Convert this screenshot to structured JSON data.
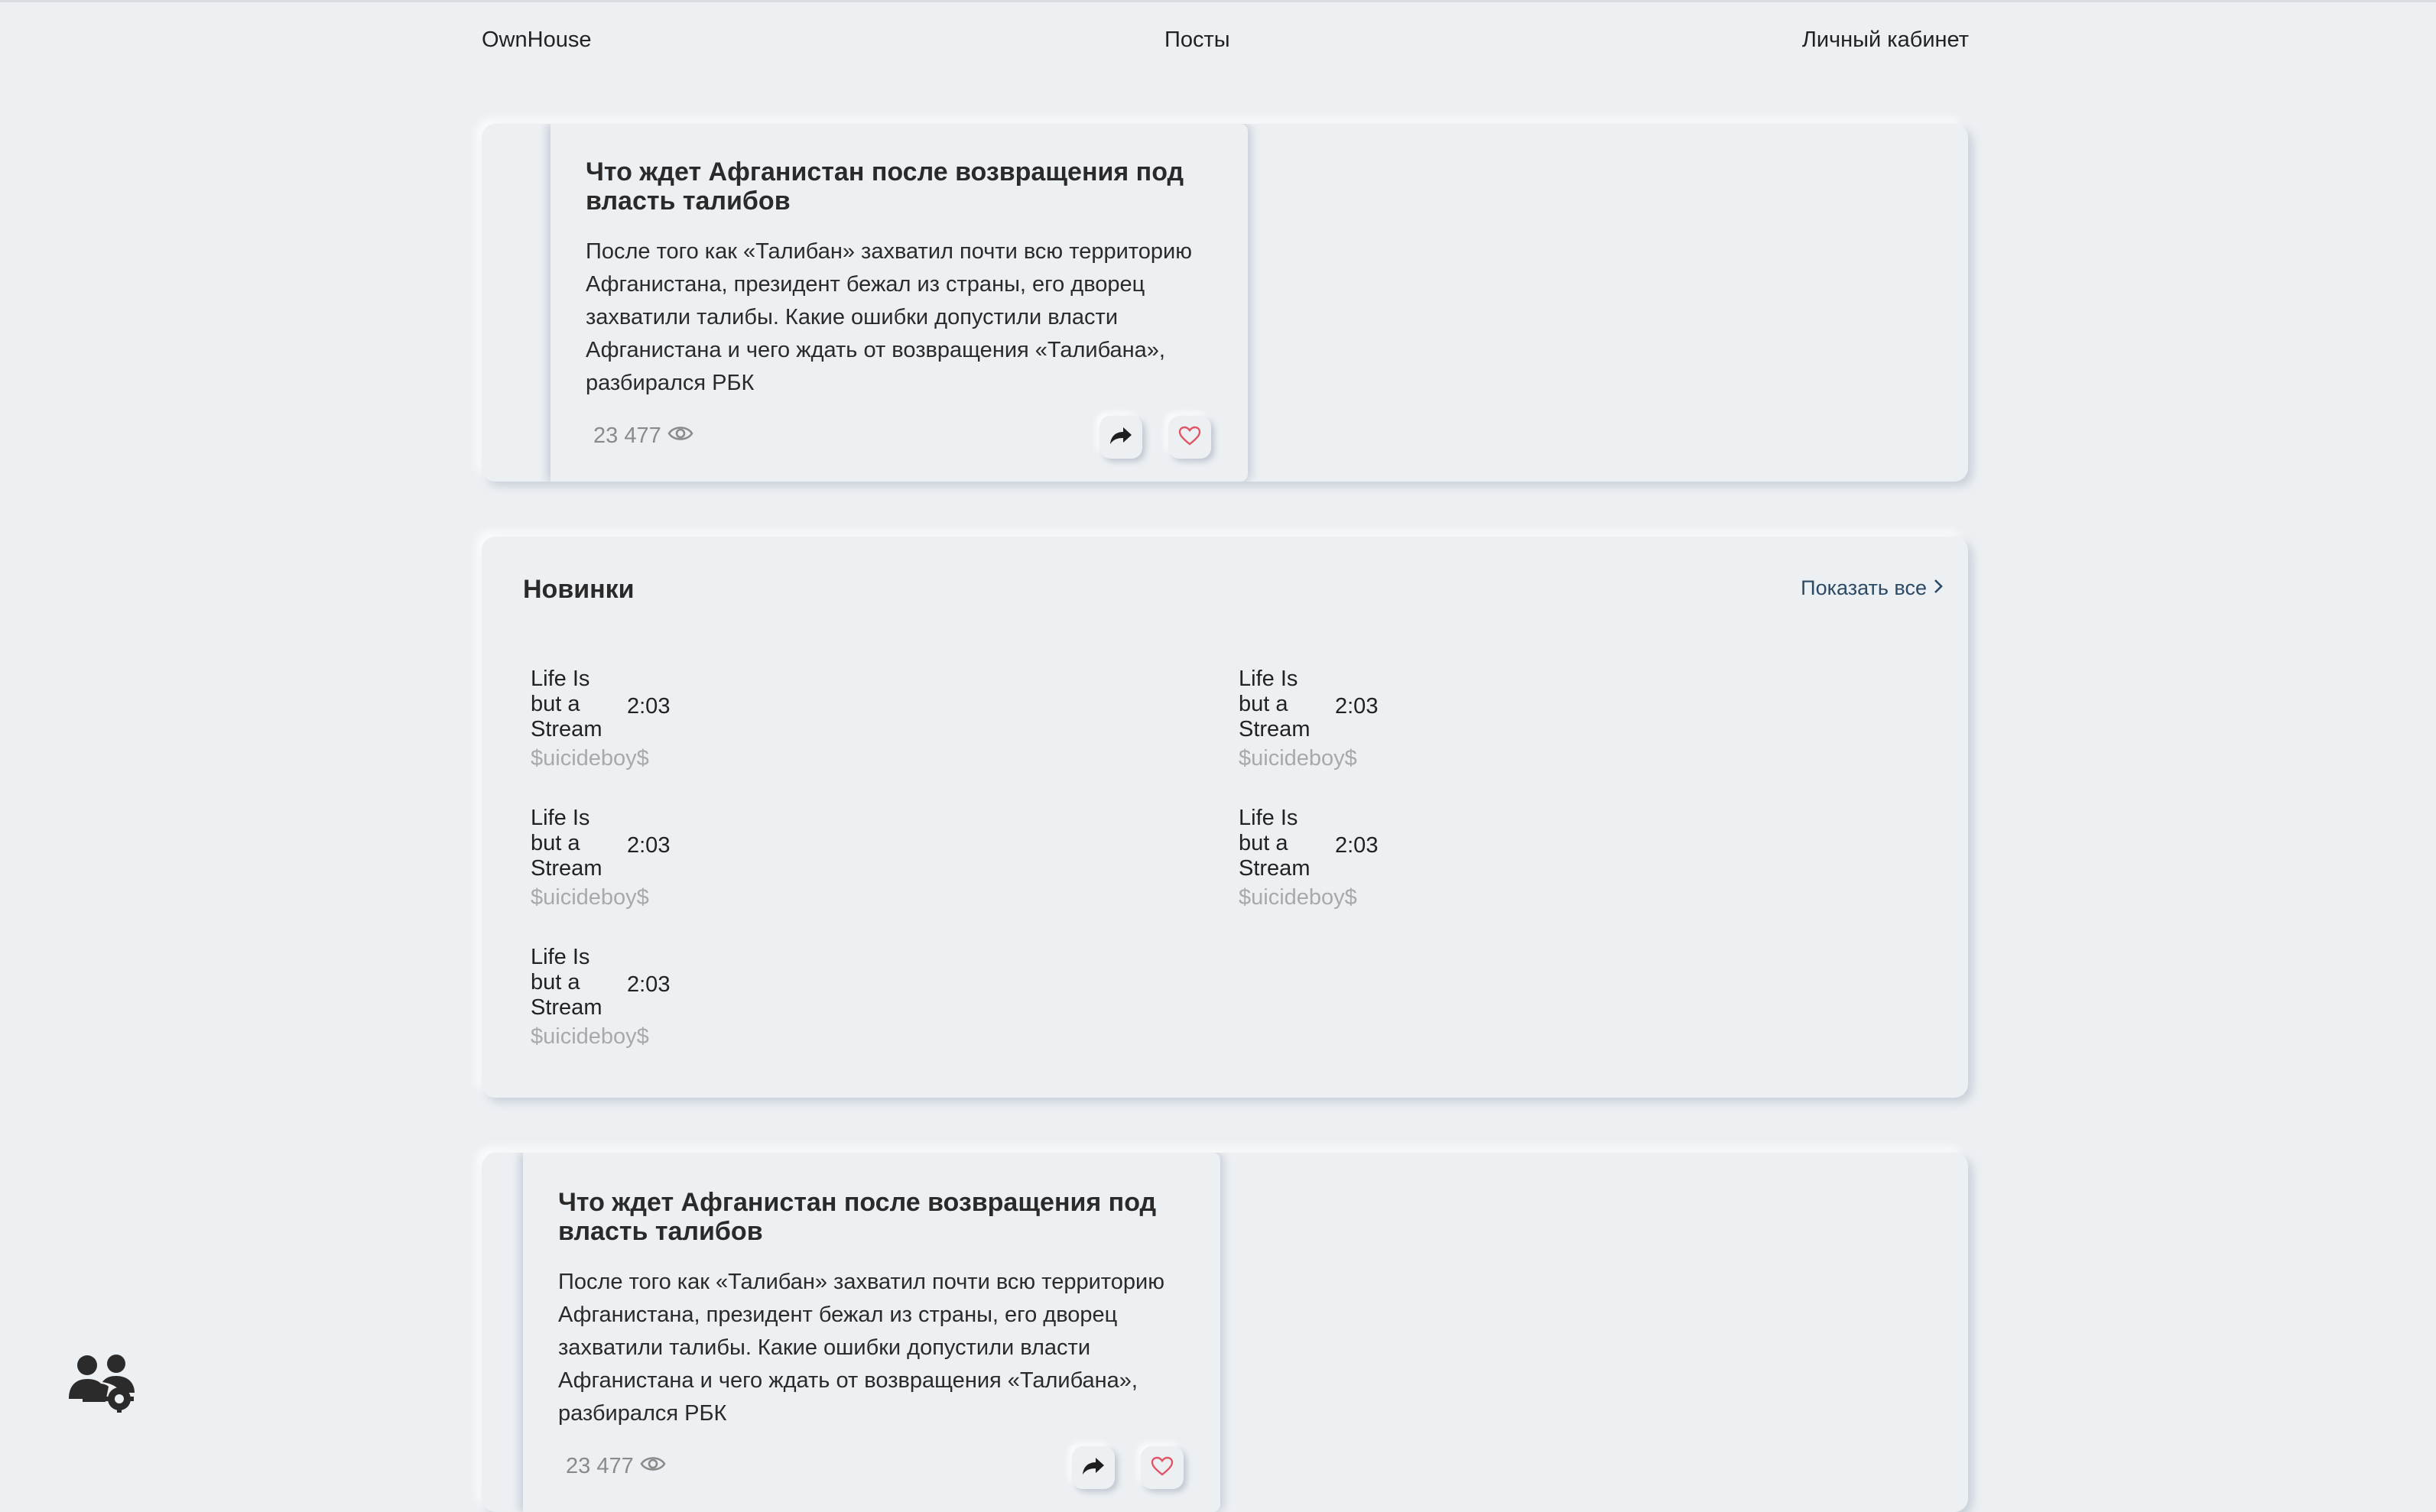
{
  "header": {
    "logo": "OwnHouse",
    "nav_posts": "Посты",
    "nav_cabinet": "Личный кабинет"
  },
  "posts": [
    {
      "title": "Что ждет Афганистан после возвращения под власть талибов",
      "body": "После того как «Талибан» захватил почти всю территорию Афганистана, президент бежал из страны, его дворец захватили талибы. Какие ошибки допустили власти Афганистана и чего ждать от возвращения «Талибана», разбирался РБК",
      "views": "23 477",
      "share_icon": "share-icon",
      "like_icon": "heart-icon"
    },
    {
      "title": "Что ждет Афганистан после возвращения под власть талибов",
      "body": "После того как «Талибан» захватил почти всю территорию Афганистана, президент бежал из страны, его дворец захватили талибы. Какие ошибки допустили власти Афганистана и чего ждать от возвращения «Талибана», разбирался РБК",
      "views": "23 477",
      "share_icon": "share-icon",
      "like_icon": "heart-icon"
    }
  ],
  "novelties": {
    "title": "Новинки",
    "show_all": "Показать все",
    "tracks": [
      {
        "name": "Life Is but a Stream",
        "duration": "2:03",
        "artist": "$uicideboy$"
      },
      {
        "name": "Life Is but a Stream",
        "duration": "2:03",
        "artist": "$uicideboy$"
      },
      {
        "name": "Life Is but a Stream",
        "duration": "2:03",
        "artist": "$uicideboy$"
      },
      {
        "name": "Life Is but a Stream",
        "duration": "2:03",
        "artist": "$uicideboy$"
      },
      {
        "name": "Life Is but a Stream",
        "duration": "2:03",
        "artist": "$uicideboy$"
      }
    ]
  },
  "colors": {
    "background": "#edf0f3",
    "text": "#222222",
    "muted": "#a9a9a9",
    "link": "#2c4a66",
    "like": "#e05565"
  },
  "floating": {
    "admin_icon": "users-gear-icon"
  }
}
